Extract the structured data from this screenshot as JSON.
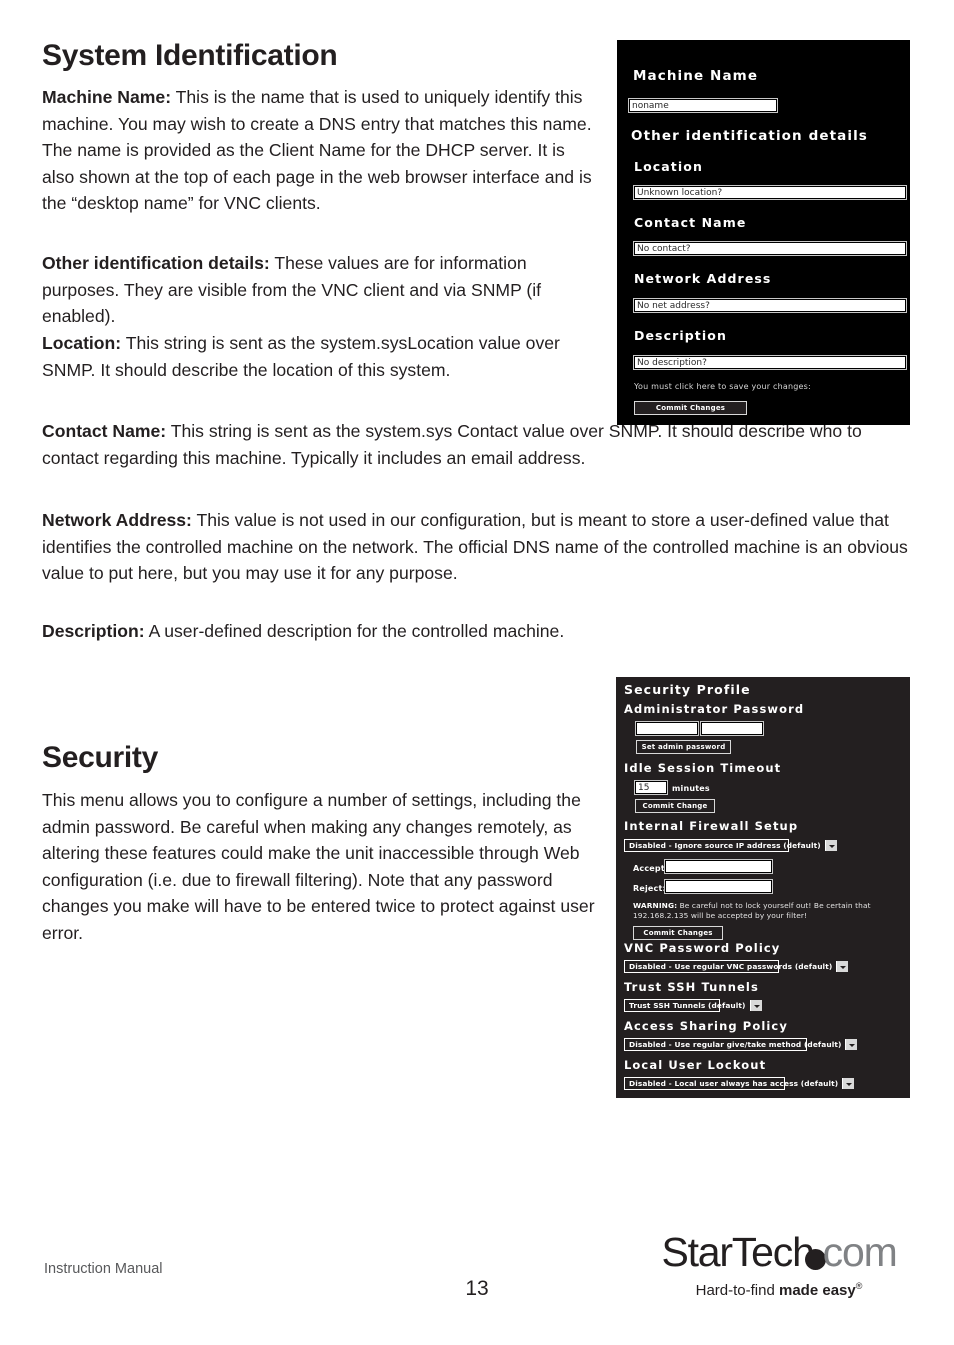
{
  "document": {
    "sections": [
      {
        "id": "system-identification",
        "title": "System Identification",
        "paragraphs": [
          {
            "lead": "Machine Name:",
            "text": " This is the name that is used to uniquely identify this machine. You may wish to create a DNS entry that matches this name. The name is provided as the Client Name for the DHCP server. It is also shown at the top of each page in the web browser interface and is the “desktop name” for VNC clients."
          },
          {
            "lead": "Other identification details:",
            "text": " These values are for information purposes. They are visible from the VNC client and via SNMP (if enabled)."
          },
          {
            "lead": "Location:",
            "text": " This string is sent as the system.sysLocation value over SNMP. It should describe the location of this system."
          },
          {
            "lead": "Contact Name:",
            "text": " This string is sent as the system.sys Contact value over SNMP. It should describe who to contact regarding this machine. Typically it includes an email address."
          },
          {
            "lead": "Network Address:",
            "text": " This value is not used in our configuration, but is meant to store a user-defined value that identifies the controlled machine on the network. The official DNS name of the controlled machine is an obvious value to put here, but you may use it for any purpose."
          },
          {
            "lead": "Description:",
            "text": " A user-defined description for the controlled machine."
          }
        ]
      },
      {
        "id": "security",
        "title": "Security",
        "paragraphs": [
          {
            "lead": "",
            "text": "This menu allows you to configure a number of settings, including the admin password. Be careful when making any changes remotely, as altering these features could make the unit inaccessible through Web configuration (i.e. due to firewall filtering). Note that any password changes you make will have to be entered twice to protect against user error."
          }
        ]
      }
    ]
  },
  "screenshot_sysid": {
    "machine_name_heading": "Machine Name",
    "machine_name_value": "noname",
    "other_details_heading": "Other identification details",
    "location_heading": "Location",
    "location_value": "Unknown location?",
    "contact_heading": "Contact Name",
    "contact_value": "No contact?",
    "network_heading": "Network Address",
    "network_value": "No net address?",
    "description_heading": "Description",
    "description_value": "No description?",
    "save_note": "You must click here to save your changes:",
    "commit_button": "Commit Changes"
  },
  "screenshot_security": {
    "panel_heading": "Security Profile",
    "admin_password_heading": "Administrator Password",
    "admin_password_value": "",
    "admin_password_confirm_value": "",
    "set_admin_button": "Set admin password",
    "idle_timeout_heading": "Idle Session Timeout",
    "idle_timeout_value": "15",
    "idle_timeout_units": "minutes",
    "idle_commit_button": "Commit Change",
    "firewall_heading": "Internal Firewall Setup",
    "firewall_mode": "Disabled - Ignore source IP address (default)",
    "accept_label": "Accept:",
    "accept_value": "",
    "reject_label": "Reject:",
    "reject_value": "",
    "warning_prefix": "WARNING:",
    "warning_text": " Be careful not to lock yourself out! Be certain that 192.168.2.135 will be accepted by your filter!",
    "firewall_commit_button": "Commit Changes",
    "vnc_policy_heading": "VNC Password Policy",
    "vnc_policy_value": "Disabled - Use regular VNC passwords (default)",
    "ssh_heading": "Trust SSH Tunnels",
    "ssh_value": "Trust SSH Tunnels (default)",
    "sharing_heading": "Access Sharing Policy",
    "sharing_value": "Disabled - Use regular give/take method (default)",
    "lockout_heading": "Local User Lockout",
    "lockout_value": "Disabled - Local user always has access (default)"
  },
  "footer": {
    "manual_label": "Instruction Manual",
    "page_number": "13",
    "logo_star": "StarTech",
    "logo_com": "com",
    "tagline_plain": "Hard-to-find ",
    "tagline_bold": "made easy",
    "tagline_reg": "®"
  }
}
